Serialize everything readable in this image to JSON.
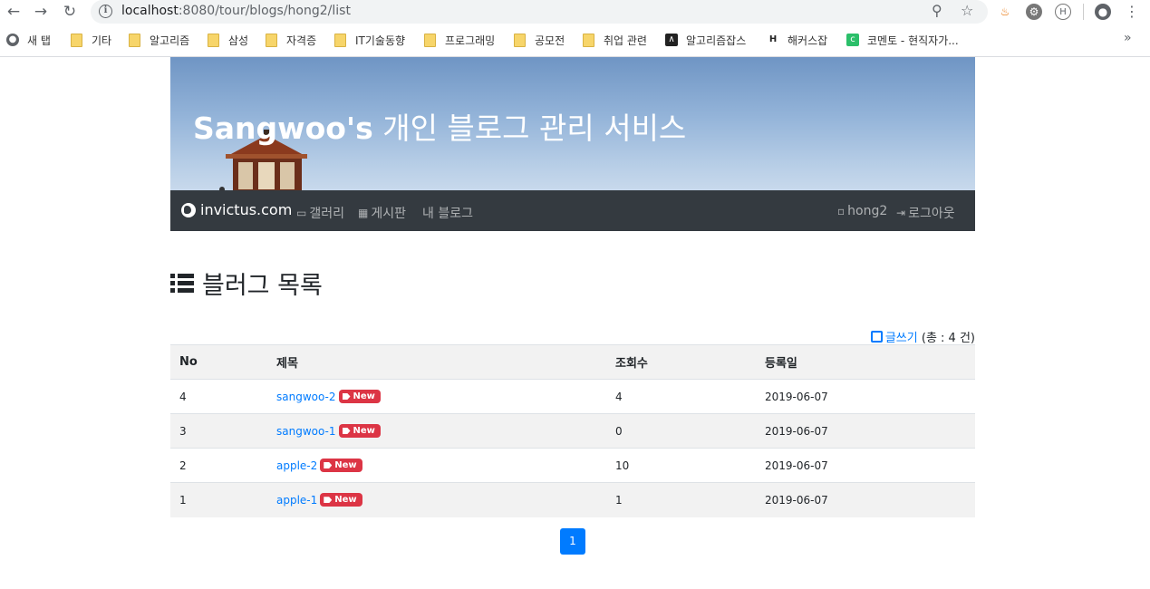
{
  "browser": {
    "url_host": "localhost",
    "url_path": ":8080/tour/blogs/hong2/list",
    "bookmarks": [
      {
        "label": "새 탭",
        "icon": "globe-icon"
      },
      {
        "label": "기타",
        "icon": "folder-icon"
      },
      {
        "label": "알고리즘",
        "icon": "folder-icon"
      },
      {
        "label": "삼성",
        "icon": "folder-icon"
      },
      {
        "label": "자격증",
        "icon": "folder-icon"
      },
      {
        "label": "IT기술동향",
        "icon": "folder-icon"
      },
      {
        "label": "프로그래밍",
        "icon": "folder-icon"
      },
      {
        "label": "공모전",
        "icon": "folder-icon"
      },
      {
        "label": "취업 관련",
        "icon": "folder-icon"
      },
      {
        "label": "알고리즘잡스",
        "icon": "site-icon"
      },
      {
        "label": "해커스잡",
        "icon": "site-icon"
      },
      {
        "label": "코멘토 - 현직자가...",
        "icon": "site-icon"
      }
    ]
  },
  "header": {
    "title_bold": "Sangwoo's",
    "title_rest": " 개인 블로그 관리 서비스"
  },
  "navbar": {
    "brand": "invictus.com",
    "links": [
      "갤러리",
      "게시판",
      "내 블로그"
    ],
    "user": "hong2",
    "logout": "로그아웃"
  },
  "page": {
    "heading": "블러그 목록",
    "write_label": "글쓰기",
    "total_text": "(총 : 4 건)"
  },
  "table": {
    "headers": [
      "No",
      "제목",
      "조회수",
      "등록일"
    ],
    "badge": "New",
    "rows": [
      {
        "no": "4",
        "title": "sangwoo-2",
        "views": "4",
        "date": "2019-06-07"
      },
      {
        "no": "3",
        "title": "sangwoo-1",
        "views": "0",
        "date": "2019-06-07"
      },
      {
        "no": "2",
        "title": "apple-2",
        "views": "10",
        "date": "2019-06-07"
      },
      {
        "no": "1",
        "title": "apple-1",
        "views": "1",
        "date": "2019-06-07"
      }
    ]
  },
  "pagination": {
    "current": "1"
  },
  "colors": {
    "accent": "#007bff",
    "navbar": "#343a40",
    "badge": "#dc3545"
  }
}
